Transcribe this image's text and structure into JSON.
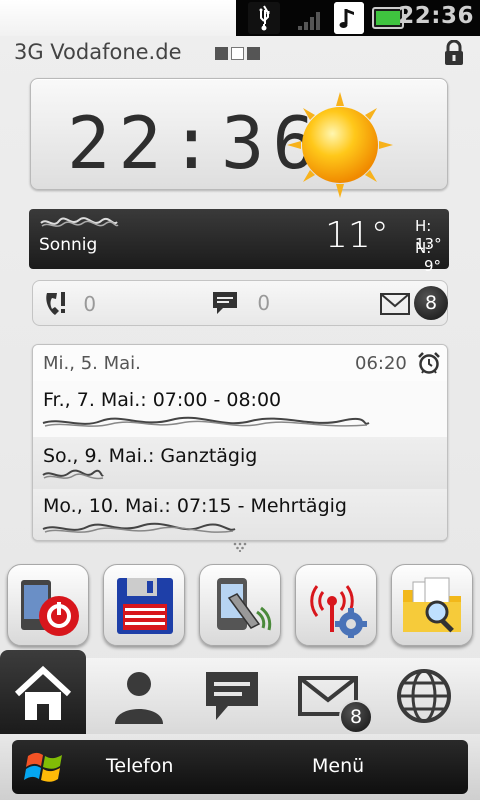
{
  "status_bar": {
    "time": "22:36",
    "icons": [
      "usb-icon",
      "signal-icon",
      "music-note-icon",
      "battery-icon"
    ]
  },
  "carrier": {
    "name": "3G Vodafone.de",
    "page_count": 3,
    "active_page": 2,
    "lock_icon": "padlock-icon"
  },
  "clock": {
    "time": "22:36",
    "weather_icon": "sun-icon"
  },
  "weather": {
    "condition": "Sonnig",
    "temperature": "11°",
    "high_label": "H:",
    "high_value": "13°",
    "low_label": "N:",
    "low_value": "9°"
  },
  "notifications": {
    "missed_calls": "0",
    "messages": "0",
    "email": "8"
  },
  "calendar": {
    "date": "Mi., 5. Mai.",
    "alarm_time": "06:20",
    "events": [
      {
        "title": "Fr., 7. Mai.: 07:00 - 08:00"
      },
      {
        "title": "So., 9. Mai.: Ganztägig"
      },
      {
        "title": "Mo., 10. Mai.: 07:15 - Mehrtägig"
      }
    ]
  },
  "apps": [
    {
      "name": "power-off-app-icon"
    },
    {
      "name": "floppy-disk-app-icon"
    },
    {
      "name": "phone-backup-app-icon"
    },
    {
      "name": "wireless-settings-app-icon"
    },
    {
      "name": "file-explorer-app-icon"
    }
  ],
  "nav": {
    "items": [
      "home-icon",
      "contacts-icon",
      "messages-icon",
      "mail-icon",
      "internet-globe-icon"
    ],
    "mail_badge": "8"
  },
  "softkeys": {
    "left": "Telefon",
    "right": "Menü"
  },
  "colors": {
    "dark_panel": "#1b1b1b",
    "background": "#eeeeee"
  }
}
